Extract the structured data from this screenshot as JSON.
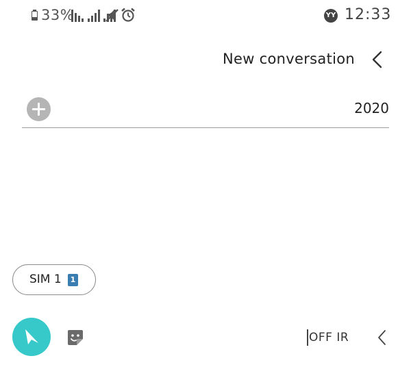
{
  "status_bar": {
    "battery_text": "33%",
    "time": "12:33",
    "carrier_badge": "YY"
  },
  "header": {
    "title": "New conversation"
  },
  "recipient": {
    "value": "2020"
  },
  "sim_chip": {
    "label": "SIM 1",
    "icon_text": "1",
    "icon_color": "#3a7db0"
  },
  "compose": {
    "ir_text": "OFF IR"
  },
  "colors": {
    "send_button": "#37c9c9",
    "add_button": "#b5b5b5"
  }
}
